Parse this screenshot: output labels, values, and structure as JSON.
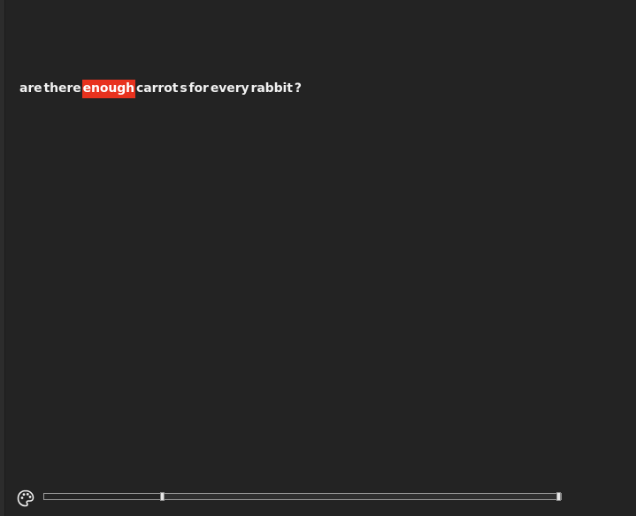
{
  "sentence": {
    "tokens": [
      {
        "text": "are",
        "highlight": false
      },
      {
        "text": "there",
        "highlight": false
      },
      {
        "text": "enough",
        "highlight": true
      },
      {
        "text": "carrot",
        "highlight": false
      },
      {
        "text": "s",
        "highlight": false
      },
      {
        "text": "for",
        "highlight": false
      },
      {
        "text": "every",
        "highlight": false
      },
      {
        "text": "rabbit",
        "highlight": false
      },
      {
        "text": "?",
        "highlight": false
      }
    ],
    "highlight_color": "#e8321e"
  },
  "controls": {
    "palette_icon": "palette-icon",
    "range": {
      "start_fraction": 0.227,
      "end_fraction": 1.0
    }
  }
}
